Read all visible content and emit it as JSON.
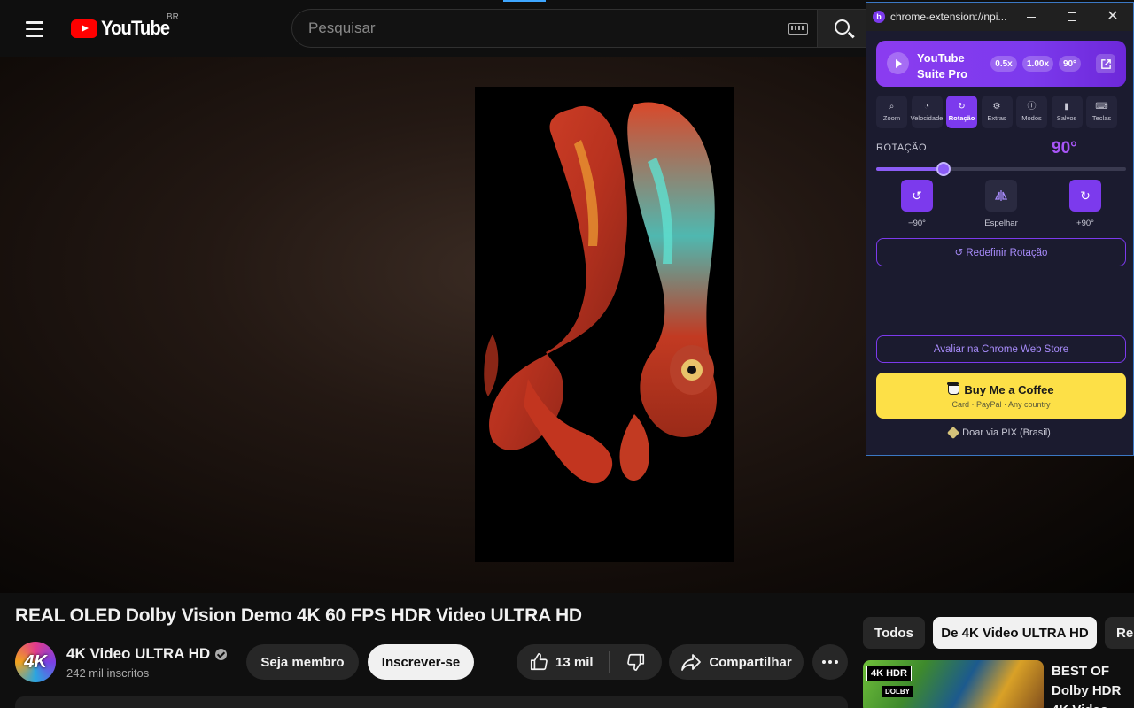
{
  "header": {
    "logo_text": "YouTube",
    "country": "BR",
    "search_placeholder": "Pesquisar"
  },
  "video": {
    "title": "REAL OLED Dolby Vision Demo 4K 60 FPS HDR Video ULTRA HD",
    "channel": {
      "avatar_text": "4K",
      "name": "4K Video ULTRA HD",
      "subscribers": "242 mil inscritos"
    },
    "buttons": {
      "member": "Seja membro",
      "subscribe": "Inscrever-se",
      "likes": "13 mil",
      "share": "Compartilhar"
    }
  },
  "chips": [
    "Todos",
    "De 4K Video ULTRA HD",
    "Re"
  ],
  "recommended": {
    "badge_hdr": "4K HDR",
    "badge_dolby": "DOLBY",
    "title": "BEST OF Dolby HDR 4K Video"
  },
  "extension": {
    "url": "chrome-extension://npi...",
    "app_name": "YouTube Suite Pro",
    "badges": [
      "0.5x",
      "1.00x",
      "90°"
    ],
    "tabs": [
      {
        "label": "Zoom",
        "icon": "zoom-icon",
        "glyph": "⌕"
      },
      {
        "label": "Velocidade",
        "icon": "speedometer-icon",
        "glyph": "◔"
      },
      {
        "label": "Rotação",
        "icon": "rotate-icon",
        "glyph": "↻"
      },
      {
        "label": "Extras",
        "icon": "gear-icon",
        "glyph": "⚙"
      },
      {
        "label": "Modos",
        "icon": "info-icon",
        "glyph": "ⓘ"
      },
      {
        "label": "Salvos",
        "icon": "bookmark-icon",
        "glyph": "▮"
      },
      {
        "label": "Teclas",
        "icon": "keyboard-icon",
        "glyph": "⌨"
      }
    ],
    "active_tab": 2,
    "rotation": {
      "label": "ROTAÇÃO",
      "value": "90°",
      "slider_fraction": 0.27,
      "left_label": "−90°",
      "mirror_label": "Espelhar",
      "right_label": "+90°"
    },
    "reset_label": "↺ Redefinir Rotação",
    "rate_label": "Avaliar na Chrome Web Store",
    "coffee_title": "Buy Me a Coffee",
    "coffee_sub": "Card · PayPal · Any country",
    "pix_label": "Doar via PIX (Brasil)",
    "accent_color": "#7c3aed"
  }
}
